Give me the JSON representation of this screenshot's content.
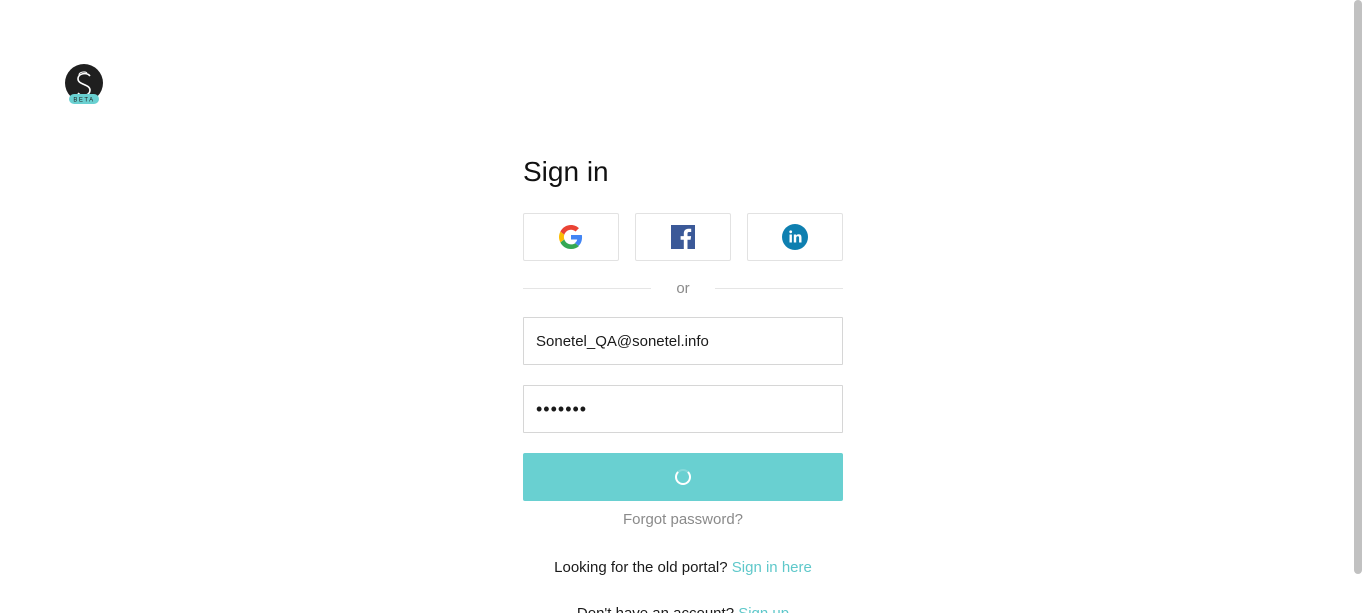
{
  "logo": {
    "badge_text": "BETA"
  },
  "signin": {
    "title": "Sign in",
    "social": {
      "google_icon": "google-icon",
      "facebook_icon": "facebook-icon",
      "linkedin_icon": "linkedin-icon"
    },
    "divider_text": "or",
    "email_value": "Sonetel_QA@sonetel.info",
    "password_value": "•••••••",
    "submit_state": "loading",
    "forgot_label": "Forgot password?",
    "old_portal_text": "Looking for the old portal?",
    "old_portal_link": "Sign in here",
    "signup_text": "Don't have an account?",
    "signup_link": "Sign up"
  },
  "colors": {
    "accent": "#69d0d1",
    "link": "#5ec8ca",
    "muted": "#8a8a8a"
  }
}
